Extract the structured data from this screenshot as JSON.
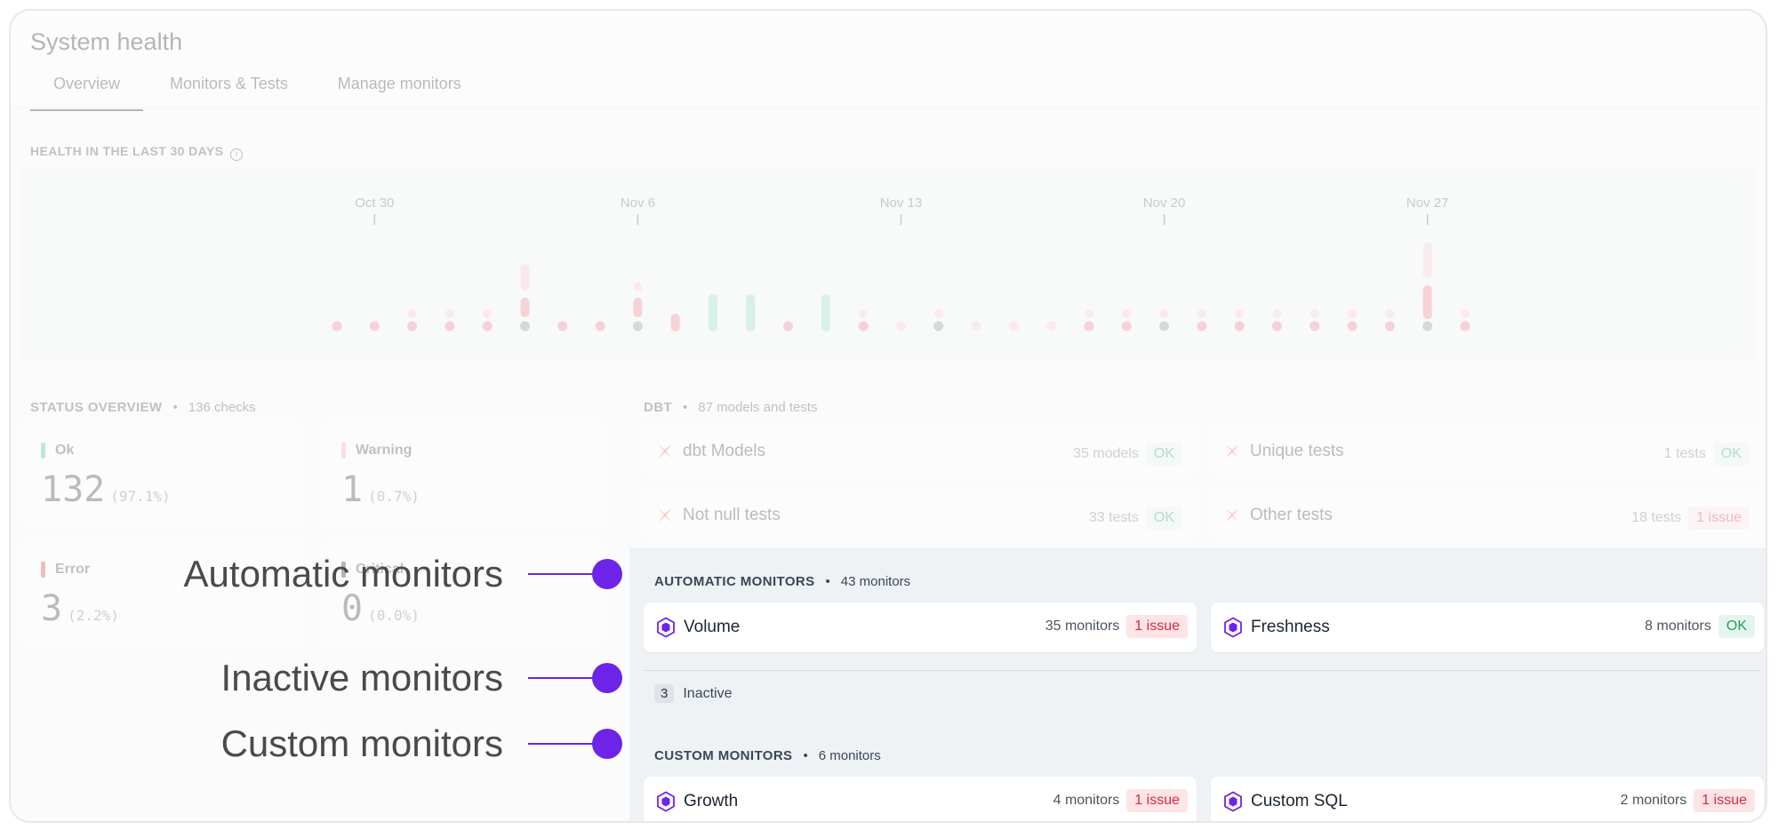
{
  "page": {
    "title": "System health"
  },
  "tabs": [
    {
      "label": "Overview",
      "active": true
    },
    {
      "label": "Monitors & Tests",
      "active": false
    },
    {
      "label": "Manage monitors",
      "active": false
    }
  ],
  "health": {
    "title": "HEALTH IN THE LAST 30 DAYS",
    "info_icon": "info-icon",
    "date_labels": [
      "Oct 30",
      "Nov 6",
      "Nov 13",
      "Nov 20",
      "Nov 27"
    ],
    "days": [
      {
        "s": "red",
        "e": []
      },
      {
        "s": "red",
        "e": []
      },
      {
        "s": "red",
        "e": [
          "pale-pink"
        ]
      },
      {
        "s": "red",
        "e": [
          "pale-pink"
        ]
      },
      {
        "s": "red",
        "e": [
          "pale-pink"
        ]
      },
      {
        "s": "gray",
        "e": [
          "pink-bar",
          "pale-bar"
        ]
      },
      {
        "s": "red",
        "e": []
      },
      {
        "s": "red",
        "e": []
      },
      {
        "s": "gray",
        "e": [
          "pink-bar",
          "pale-pink"
        ]
      },
      {
        "s": "pink-bar",
        "e": []
      },
      {
        "s": "green-bar",
        "e": []
      },
      {
        "s": "green-bar",
        "e": []
      },
      {
        "s": "red",
        "e": []
      },
      {
        "s": "green-bar",
        "e": []
      },
      {
        "s": "red",
        "e": [
          "pale-pink"
        ]
      },
      {
        "s": "pale-pink",
        "e": []
      },
      {
        "s": "gray",
        "e": [
          "pale-pink"
        ]
      },
      {
        "s": "pale-pink",
        "e": []
      },
      {
        "s": "pale-pink",
        "e": []
      },
      {
        "s": "pale-pink",
        "e": []
      },
      {
        "s": "red",
        "e": [
          "pale-pink"
        ]
      },
      {
        "s": "red",
        "e": [
          "pale-pink"
        ]
      },
      {
        "s": "gray",
        "e": [
          "pale-pink"
        ]
      },
      {
        "s": "red",
        "e": [
          "pale-pink"
        ]
      },
      {
        "s": "red",
        "e": [
          "pale-pink"
        ]
      },
      {
        "s": "red",
        "e": [
          "pale-pink"
        ]
      },
      {
        "s": "red",
        "e": [
          "pale-pink"
        ]
      },
      {
        "s": "red",
        "e": [
          "pale-pink"
        ]
      },
      {
        "s": "red",
        "e": [
          "pale-pink"
        ]
      },
      {
        "s": "gray",
        "e": [
          "pink-tall",
          "pale-tall"
        ]
      },
      {
        "s": "red",
        "e": [
          "pale-pink"
        ]
      }
    ]
  },
  "status_overview": {
    "title": "STATUS OVERVIEW",
    "count": "136 checks",
    "cards": [
      {
        "label": "Ok",
        "value": "132",
        "percent": "(97.1%)",
        "color": "#2fbf7a"
      },
      {
        "label": "Warning",
        "value": "1",
        "percent": "(0.7%)",
        "color": "#f5a1ab"
      },
      {
        "label": "Error",
        "value": "3",
        "percent": "(2.2%)",
        "color": "#e0334b"
      },
      {
        "label": "Critical",
        "value": "0",
        "percent": "(0.0%)",
        "color": "#1b2530"
      }
    ]
  },
  "dbt": {
    "title": "DBT",
    "count": "87 models and tests",
    "cards": [
      {
        "name": "dbt Models",
        "count": "35 models",
        "status": "OK",
        "status_type": "ok"
      },
      {
        "name": "Unique tests",
        "count": "1 tests",
        "status": "OK",
        "status_type": "ok"
      },
      {
        "name": "Not null tests",
        "count": "33 tests",
        "status": "OK",
        "status_type": "ok"
      },
      {
        "name": "Other tests",
        "count": "18 tests",
        "status": "1 issue",
        "status_type": "issue"
      }
    ]
  },
  "automatic_monitors": {
    "title": "AUTOMATIC MONITORS",
    "count": "43 monitors",
    "cards": [
      {
        "name": "Volume",
        "count": "35 monitors",
        "status": "1 issue",
        "status_type": "issue"
      },
      {
        "name": "Freshness",
        "count": "8 monitors",
        "status": "OK",
        "status_type": "ok"
      }
    ]
  },
  "inactive": {
    "count": "3",
    "label": "Inactive"
  },
  "custom_monitors": {
    "title": "CUSTOM MONITORS",
    "count": "6 monitors",
    "cards": [
      {
        "name": "Growth",
        "count": "4 monitors",
        "status": "1 issue",
        "status_type": "issue"
      },
      {
        "name": "Custom SQL",
        "count": "2 monitors",
        "status": "1 issue",
        "status_type": "issue"
      }
    ]
  },
  "annotations": {
    "automatic": "Automatic monitors",
    "inactive": "Inactive monitors",
    "custom": "Custom monitors",
    "accent_color": "#6d24e8"
  },
  "colors": {
    "ok": "#1f9e63",
    "issue": "#d42b3c",
    "monitor_icon": "#6d24e8"
  }
}
